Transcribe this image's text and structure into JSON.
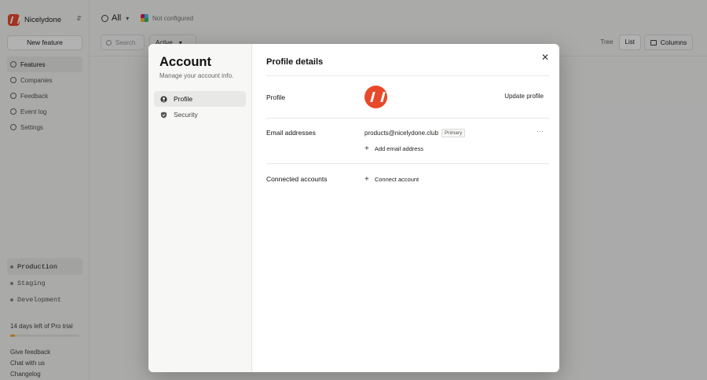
{
  "workspace": {
    "name": "Nicelydone"
  },
  "sidebar": {
    "new_feature": "New feature",
    "items": [
      {
        "label": "Features",
        "active": true
      },
      {
        "label": "Companies",
        "active": false
      },
      {
        "label": "Feedback",
        "active": false
      },
      {
        "label": "Event log",
        "active": false
      },
      {
        "label": "Settings",
        "active": false
      }
    ],
    "environments": [
      {
        "label": "Production",
        "active": true
      },
      {
        "label": "Staging",
        "active": false
      },
      {
        "label": "Development",
        "active": false
      }
    ],
    "trial_text": "14 days left of Pro trial",
    "trial_progress": 0.07,
    "footer": [
      "Give feedback",
      "Chat with us",
      "Changelog"
    ]
  },
  "topbar": {
    "scope": "All",
    "integration_status": "Not configured"
  },
  "toolbar": {
    "search_placeholder": "Search",
    "filter": "Active",
    "views": [
      "Tree",
      "List"
    ],
    "selected_view": "List",
    "columns": "Columns"
  },
  "modal": {
    "title": "Account",
    "subtitle": "Manage your account info.",
    "nav": [
      {
        "label": "Profile",
        "icon": "user-circle-icon",
        "active": true
      },
      {
        "label": "Security",
        "icon": "shield-icon",
        "active": false
      }
    ],
    "heading": "Profile details",
    "profile_label": "Profile",
    "update_profile": "Update profile",
    "email_label": "Email addresses",
    "email": "products@nicelydone.club",
    "email_badge": "Primary",
    "add_email": "Add email address",
    "connected_label": "Connected accounts",
    "connect_account": "Connect account"
  },
  "colors": {
    "brand": "#e8492b",
    "trial_bar": "#f5a623"
  }
}
